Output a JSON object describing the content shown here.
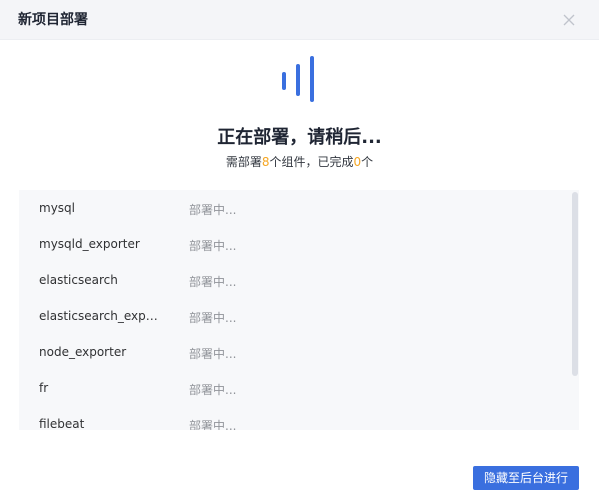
{
  "dialog": {
    "title": "新项目部署",
    "close_icon": "close-icon"
  },
  "status": {
    "title": "正在部署，请稍后...",
    "sub_prefix": "需部署",
    "total": "8",
    "sub_middle": "个组件，已完成",
    "done": "0",
    "sub_suffix": "个"
  },
  "components": [
    {
      "name": "mysql",
      "status": "部署中..."
    },
    {
      "name": "mysqld_exporter",
      "status": "部署中..."
    },
    {
      "name": "elasticsearch",
      "status": "部署中..."
    },
    {
      "name": "elasticsearch_exporter",
      "status": "部署中..."
    },
    {
      "name": "node_exporter",
      "status": "部署中..."
    },
    {
      "name": "fr",
      "status": "部署中..."
    },
    {
      "name": "filebeat",
      "status": "部署中..."
    }
  ],
  "footer": {
    "background_button": "隐藏至后台进行"
  },
  "colors": {
    "accent": "#3a6fdf",
    "highlight_number": "#f5a623"
  }
}
